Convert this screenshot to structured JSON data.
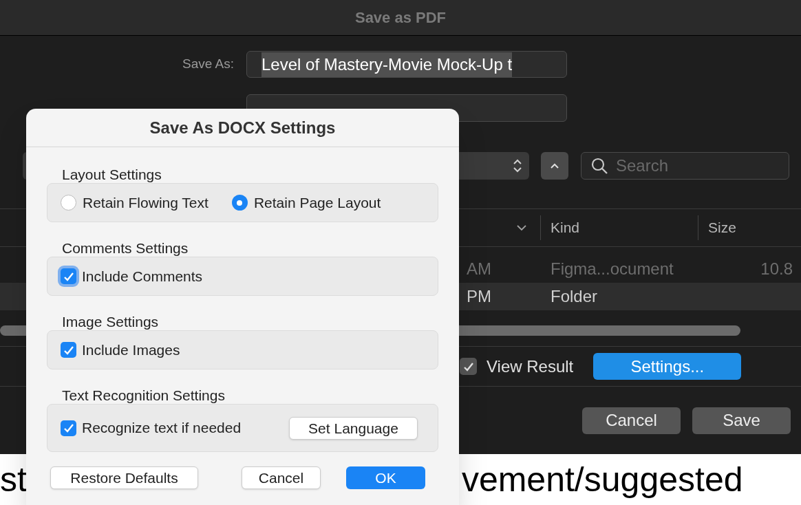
{
  "window": {
    "title": "Save as PDF"
  },
  "save_as": {
    "label": "Save As:",
    "value": "Level of Mastery-Movie Mock-Up t",
    "text_selected": true
  },
  "search": {
    "placeholder": "Search"
  },
  "table": {
    "columns": [
      {
        "label": "Kind"
      },
      {
        "label": "Size"
      }
    ],
    "rows": [
      {
        "date": "AM",
        "kind": "Figma...ocument",
        "size": "10.8",
        "selected": false,
        "disabled": true
      },
      {
        "date": "PM",
        "kind": "Folder",
        "selected": true,
        "disabled": false
      }
    ]
  },
  "view_result": {
    "label": "View Result",
    "checked": true
  },
  "settings_button": "Settings...",
  "buttons": [
    "Cancel",
    "Save"
  ],
  "document_text": [
    "st",
    "vement/suggested"
  ],
  "dialog": {
    "title": "Save As DOCX Settings",
    "sections": [
      {
        "title": "Layout Settings",
        "kind": "radio",
        "options": [
          {
            "label": "Retain Flowing Text",
            "selected": false
          },
          {
            "label": "Retain Page Layout",
            "selected": true
          }
        ]
      },
      {
        "title": "Comments Settings",
        "kind": "checkbox",
        "options": [
          {
            "label": "Include Comments",
            "checked": true,
            "focused": true
          }
        ]
      },
      {
        "title": "Image Settings",
        "kind": "checkbox",
        "options": [
          {
            "label": "Include Images",
            "checked": true
          }
        ]
      },
      {
        "title": "Text Recognition Settings",
        "kind": "checkbox",
        "options": [
          {
            "label": "Recognize text if needed",
            "checked": true
          }
        ],
        "button": "Set Language"
      }
    ],
    "buttons": [
      {
        "label": "Restore Defaults",
        "default": false
      },
      {
        "label": "Cancel",
        "default": false
      },
      {
        "label": "OK",
        "default": true
      }
    ]
  }
}
